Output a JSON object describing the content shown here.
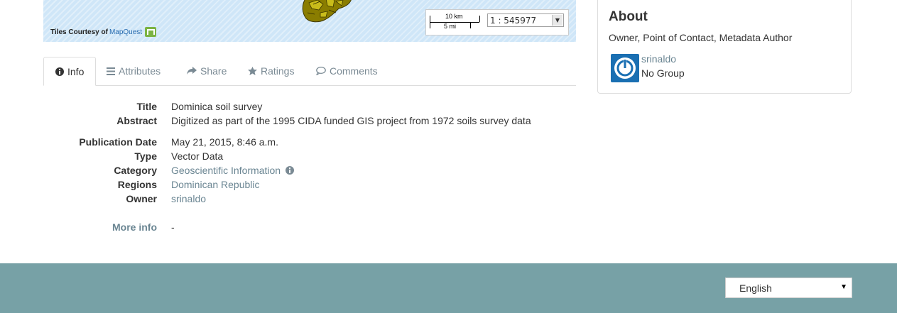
{
  "map": {
    "attribution_prefix": "Tiles Courtesy of",
    "attribution_link": "MapQuest",
    "scale_km": "10 km",
    "scale_mi": "5 mi",
    "scale_value": "1 : 545977",
    "water_color": "#cfe6f8",
    "land_color": "#8a7d00"
  },
  "tabs": [
    {
      "label": "Info",
      "icon": "info-circle-icon",
      "active": true
    },
    {
      "label": "Attributes",
      "icon": "list-icon",
      "active": false
    },
    {
      "label": "Share",
      "icon": "share-icon",
      "active": false
    },
    {
      "label": "Ratings",
      "icon": "star-icon",
      "active": false
    },
    {
      "label": "Comments",
      "icon": "comment-icon",
      "active": false
    }
  ],
  "info": {
    "title_label": "Title",
    "title_value": "Dominica soil survey",
    "abstract_label": "Abstract",
    "abstract_value": "Digitized as part of the 1995 CIDA funded GIS project from 1972 soils survey data",
    "pubdate_label": "Publication Date",
    "pubdate_value": "May 21, 2015, 8:46 a.m.",
    "type_label": "Type",
    "type_value": "Vector Data",
    "category_label": "Category",
    "category_value": "Geoscientific Information",
    "regions_label": "Regions",
    "regions_value": "Dominican Republic",
    "owner_label": "Owner",
    "owner_value": "srinaldo",
    "moreinfo_label": "More info",
    "moreinfo_value": "-"
  },
  "about": {
    "heading": "About",
    "roles": "Owner, Point of Contact, Metadata Author",
    "username": "srinaldo",
    "group": "No Group",
    "avatar_color": "#1a6fb2"
  },
  "footer": {
    "language": "English",
    "background": "#77a1a6"
  }
}
